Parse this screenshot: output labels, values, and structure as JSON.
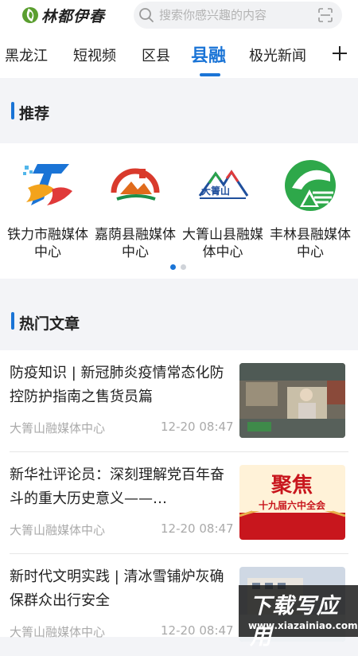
{
  "app": {
    "logo_text": "林都伊春"
  },
  "search": {
    "placeholder": "搜索你感兴趣的内容"
  },
  "tabs": [
    {
      "label": "黑龙江",
      "active": false
    },
    {
      "label": "短视频",
      "active": false
    },
    {
      "label": "区县",
      "active": false
    },
    {
      "label": "县融",
      "active": true
    },
    {
      "label": "极光新闻",
      "active": false
    }
  ],
  "sections": {
    "recommend": "推荐",
    "hot": "热门文章"
  },
  "recommend": [
    {
      "line1": "铁力市融媒体",
      "line2": "中心",
      "icon": "tieli-logo-icon"
    },
    {
      "line1": "嘉荫县融媒体",
      "line2": "中心",
      "icon": "jiayin-logo-icon"
    },
    {
      "line1": "大箐山县融媒",
      "line2": "体中心",
      "icon": "dajingshan-logo-icon"
    },
    {
      "line1": "丰林县融媒体",
      "line2": "中心",
      "icon": "fenglin-logo-icon"
    }
  ],
  "carousel": {
    "pages": 2,
    "current": 1
  },
  "articles": [
    {
      "title": "防疫知识 | 新冠肺炎疫情常态化防控防护指南之售货员篇",
      "source": "大箐山融媒体中心",
      "time": "12-20 08:47"
    },
    {
      "title": "新华社评论员：深刻理解党百年奋斗的重大历史意义——…",
      "source": "大箐山融媒体中心",
      "time": "12-20 08:47"
    },
    {
      "title": "新时代文明实践 | 清冰雪铺炉灰确保群众出行安全",
      "source": "大箐山融媒体中心",
      "time": "12-20 08:47"
    }
  ],
  "thumb2": {
    "line1": "聚焦",
    "line2": "十九届六中全会"
  },
  "watermark": {
    "logo": "下载写应用",
    "url": "www.xiazainiao.com"
  },
  "colors": {
    "accent": "#1a74d6",
    "brand_green": "#5a9e2f"
  }
}
